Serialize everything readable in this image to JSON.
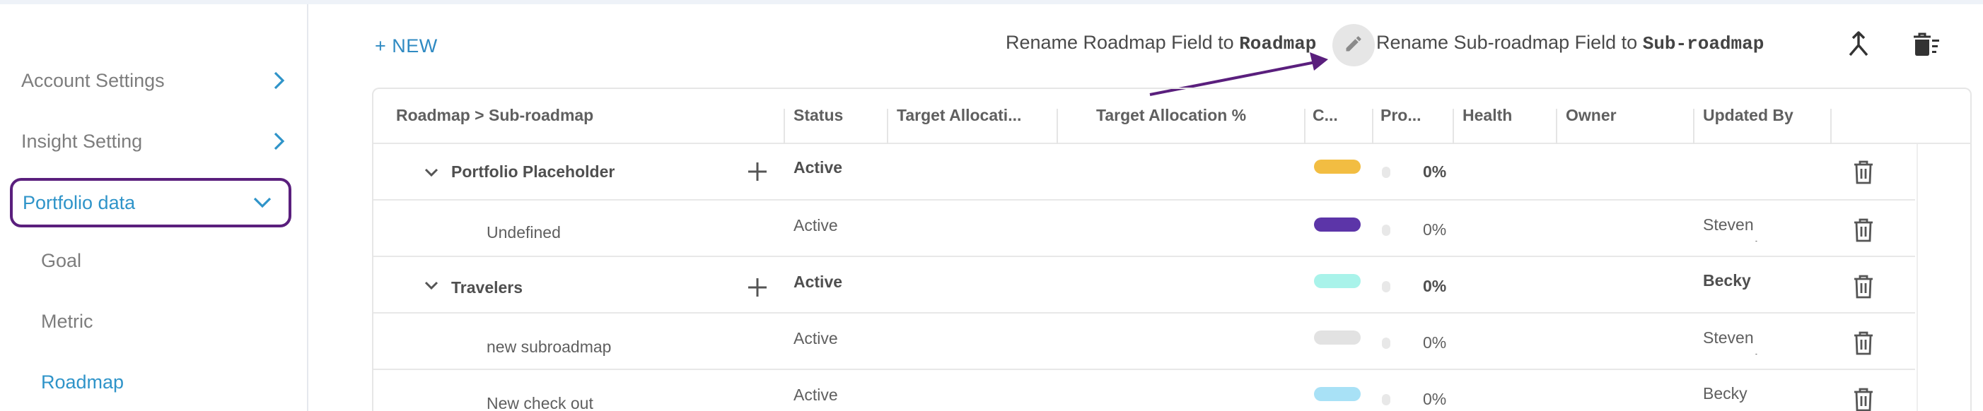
{
  "sidebar": {
    "items": [
      {
        "label": "Account Settings",
        "active": false
      },
      {
        "label": "Insight Setting",
        "active": false
      },
      {
        "label": "Portfolio data",
        "active": true,
        "expanded": true
      }
    ],
    "subitems": [
      {
        "label": "Goal",
        "active": false
      },
      {
        "label": "Metric",
        "active": false
      },
      {
        "label": "Roadmap",
        "active": true
      }
    ]
  },
  "toolbar": {
    "new_label": "+ NEW",
    "rename_roadmap_prefix": "Rename Roadmap Field to",
    "rename_roadmap_value": "Roadmap",
    "rename_sub_prefix": "Rename Sub-roadmap Field to",
    "rename_sub_value": "Sub-roadmap",
    "icons": [
      "edit-icon",
      "merge-icon",
      "bulk-delete-icon"
    ]
  },
  "table": {
    "columns": [
      "Roadmap > Sub-roadmap",
      "Status",
      "Target Allocati...",
      "Target Allocation %",
      "C...",
      "Pro...",
      "Health",
      "Owner",
      "Updated By"
    ],
    "rows": [
      {
        "name": "Portfolio Placeholder",
        "level": 0,
        "status": "Active",
        "color": "#f2bd42",
        "progress": "0%",
        "updated_by": ""
      },
      {
        "name": "Undefined",
        "level": 1,
        "status": "Active",
        "color": "#5c35a8",
        "progress": "0%",
        "updated_by": "Steven Fennerine"
      },
      {
        "name": "Travelers",
        "level": 0,
        "status": "Active",
        "color": "#a9f3ea",
        "progress": "0%",
        "updated_by": "Becky"
      },
      {
        "name": "new subroadmap",
        "level": 1,
        "status": "Active",
        "color": "#e2e2e2",
        "progress": "0%",
        "updated_by": "Steven Fennerine"
      },
      {
        "name": "New check out",
        "level": 1,
        "status": "Active",
        "color": "#a8e1f6",
        "progress": "0%",
        "updated_by": "Becky"
      }
    ]
  },
  "colors": {
    "accent": "#2f94c9",
    "highlight_outline": "#5a1f7d",
    "annotation_arrow": "#5a1f7d"
  }
}
